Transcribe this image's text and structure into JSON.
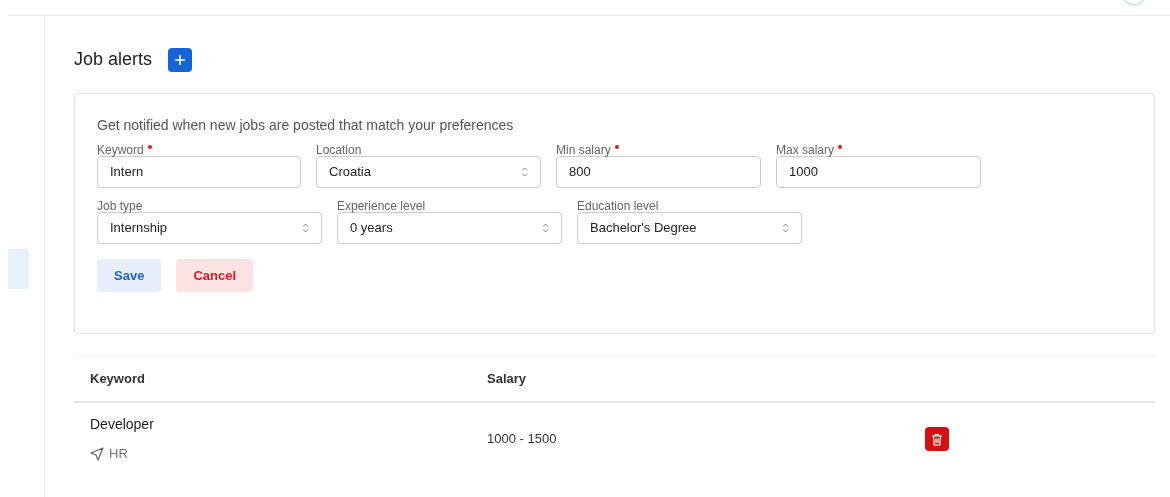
{
  "title": "Job alerts",
  "form": {
    "description": "Get notified when new jobs are posted that match your preferences",
    "rows": [
      [
        {
          "label": "Keyword",
          "required": true,
          "kind": "input",
          "value": "Intern"
        },
        {
          "label": "Location",
          "required": false,
          "kind": "select",
          "value": "Croatia"
        },
        {
          "label": "Min salary",
          "required": true,
          "kind": "input",
          "value": "800"
        },
        {
          "label": "Max salary",
          "required": true,
          "kind": "input",
          "value": "1000"
        }
      ],
      [
        {
          "label": "Job type",
          "required": false,
          "kind": "select",
          "value": "Internship"
        },
        {
          "label": "Experience level",
          "required": false,
          "kind": "select",
          "value": "0 years"
        },
        {
          "label": "Education level",
          "required": false,
          "kind": "select",
          "value": "Bachelor's Degree"
        }
      ]
    ],
    "buttons": [
      {
        "label": "Save",
        "kind": "primary"
      },
      {
        "label": "Cancel",
        "kind": "danger"
      }
    ]
  },
  "table": {
    "columns": [
      "Keyword",
      "Salary"
    ],
    "rows": [
      {
        "keyword": "Developer",
        "channel": "HR",
        "salary": "1000 - 1500"
      }
    ]
  }
}
